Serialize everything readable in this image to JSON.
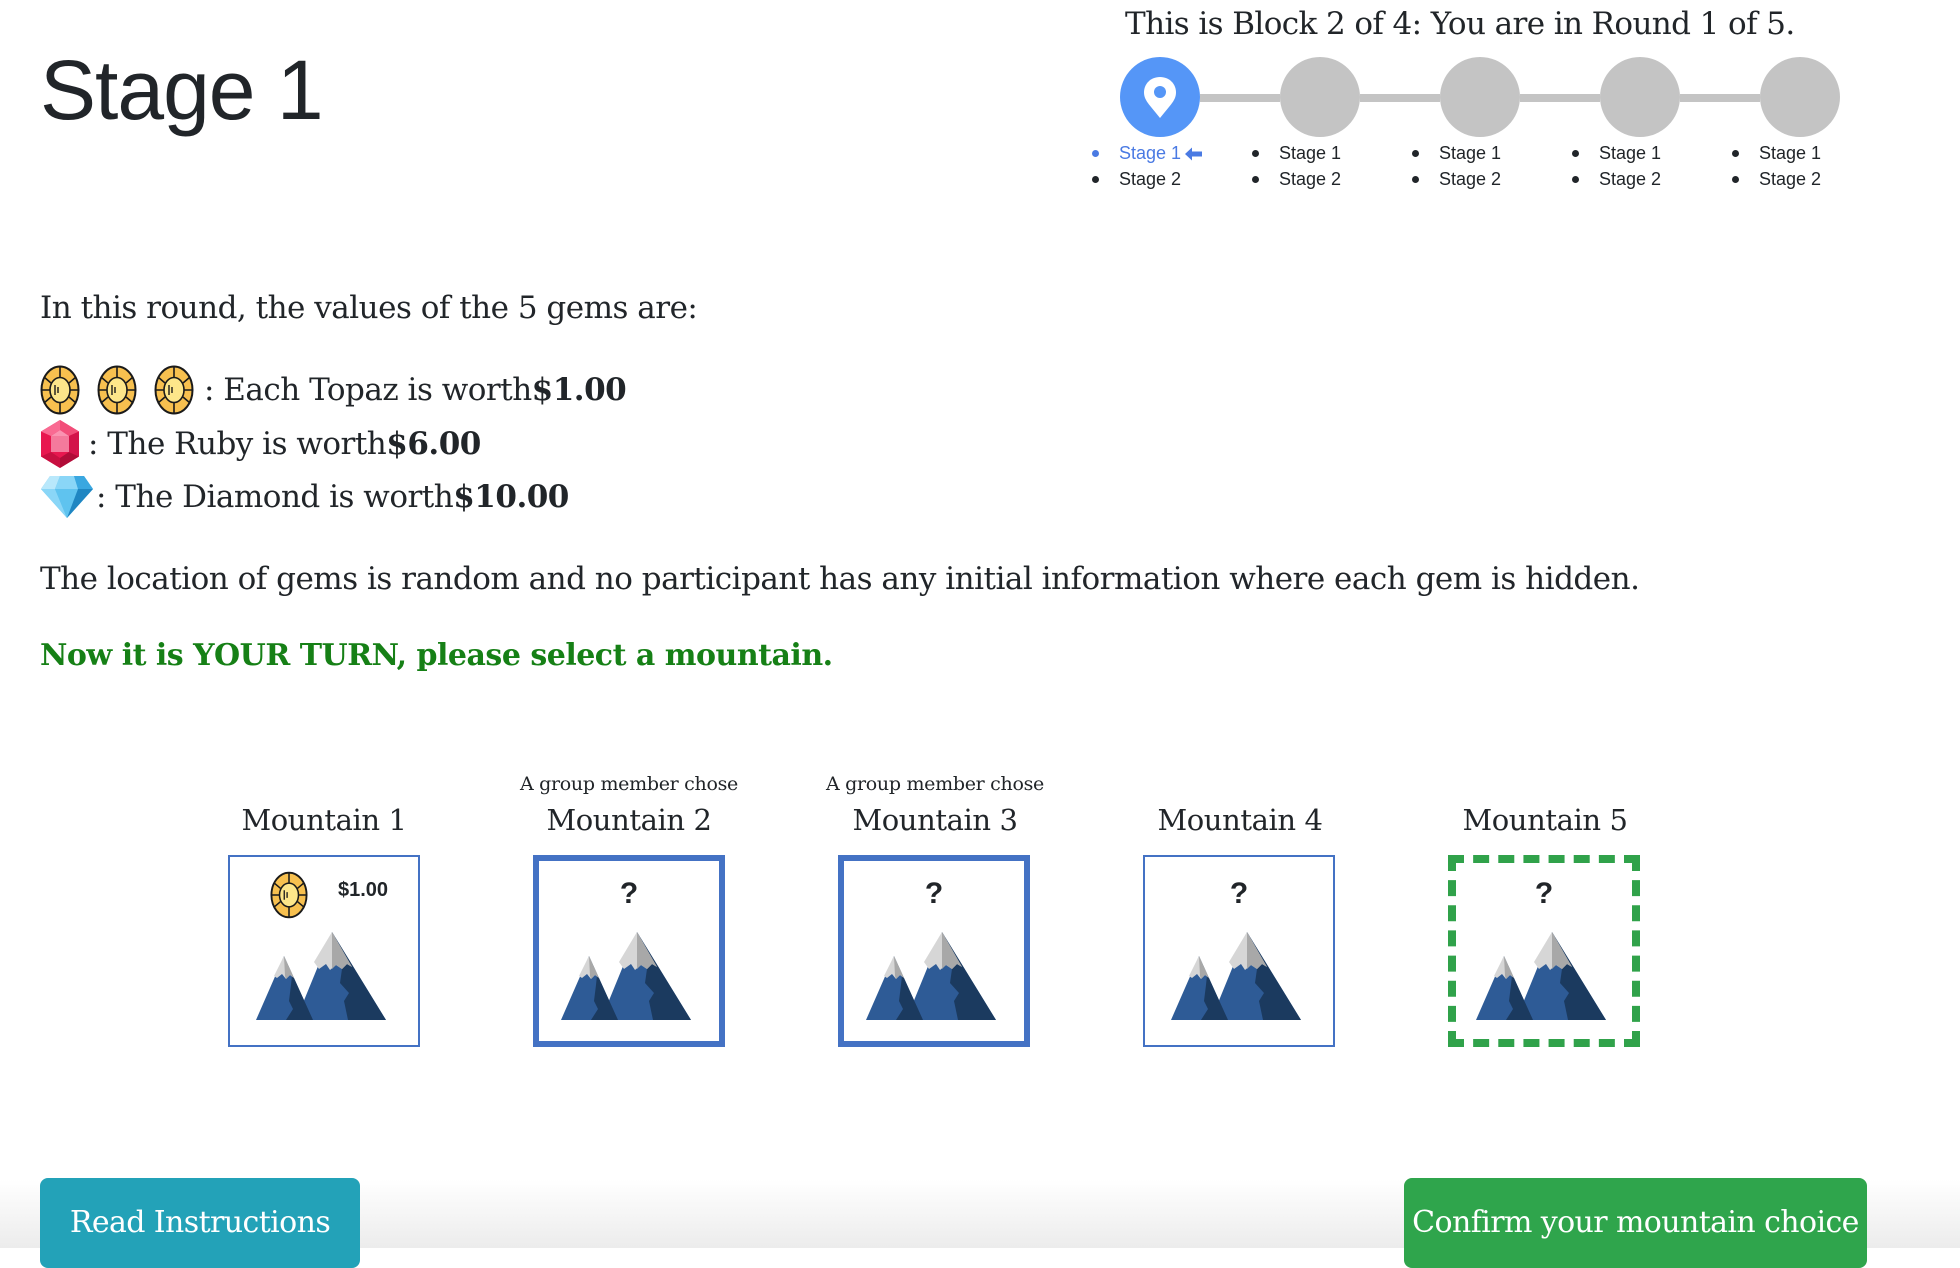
{
  "page": {
    "title": "Stage 1"
  },
  "progress": {
    "title": "This is Block 2 of 4: You are in Round 1 of 5.",
    "current_round": 1,
    "total_rounds": 5,
    "current_block": 2,
    "total_blocks": 4,
    "rounds": [
      {
        "active": true,
        "icon": "map-pin-icon",
        "stages": [
          "Stage 1",
          "Stage 2"
        ],
        "current_stage_index": 0
      },
      {
        "active": false,
        "stages": [
          "Stage 1",
          "Stage 2"
        ]
      },
      {
        "active": false,
        "stages": [
          "Stage 1",
          "Stage 2"
        ]
      },
      {
        "active": false,
        "stages": [
          "Stage 1",
          "Stage 2"
        ]
      },
      {
        "active": false,
        "stages": [
          "Stage 1",
          "Stage 2"
        ]
      }
    ],
    "colors": {
      "active": "#5596f7",
      "inactive": "#c4c4c4",
      "current_stage_text": "#4a7ae3"
    }
  },
  "gems": {
    "intro": "In this round, the values of the 5 gems are:",
    "rows": [
      {
        "gem": "topaz",
        "count": 3,
        "text": ": Each Topaz is worth ",
        "value": "$1.00"
      },
      {
        "gem": "ruby",
        "count": 1,
        "text": ": The Ruby is worth ",
        "value": "$6.00"
      },
      {
        "gem": "diamond",
        "count": 1,
        "text": ": The Diamond is worth ",
        "value": "$10.00"
      }
    ]
  },
  "info_text": "The location of gems is random and no participant has any initial information where each gem is hidden.",
  "turn_prompt": "Now it is YOUR TURN, please select a mountain.",
  "mountains": [
    {
      "label": "Mountain 1",
      "note": "",
      "state": "revealed",
      "gem": "topaz",
      "value": "$1.00"
    },
    {
      "label": "Mountain 2",
      "note": "A group member chose",
      "state": "chosen",
      "placeholder": "?"
    },
    {
      "label": "Mountain 3",
      "note": "A group member chose",
      "state": "chosen",
      "placeholder": "?"
    },
    {
      "label": "Mountain 4",
      "note": "",
      "state": "default",
      "placeholder": "?"
    },
    {
      "label": "Mountain 5",
      "note": "",
      "state": "selected",
      "placeholder": "?"
    }
  ],
  "buttons": {
    "read_instructions": "Read Instructions",
    "confirm": "Confirm your mountain choice"
  },
  "colors": {
    "turn_prompt": "#168016",
    "chosen_border": "#4472c4",
    "selected_border": "#30a24a",
    "read_button": "#23a2b8",
    "confirm_button": "#2fa54c"
  }
}
